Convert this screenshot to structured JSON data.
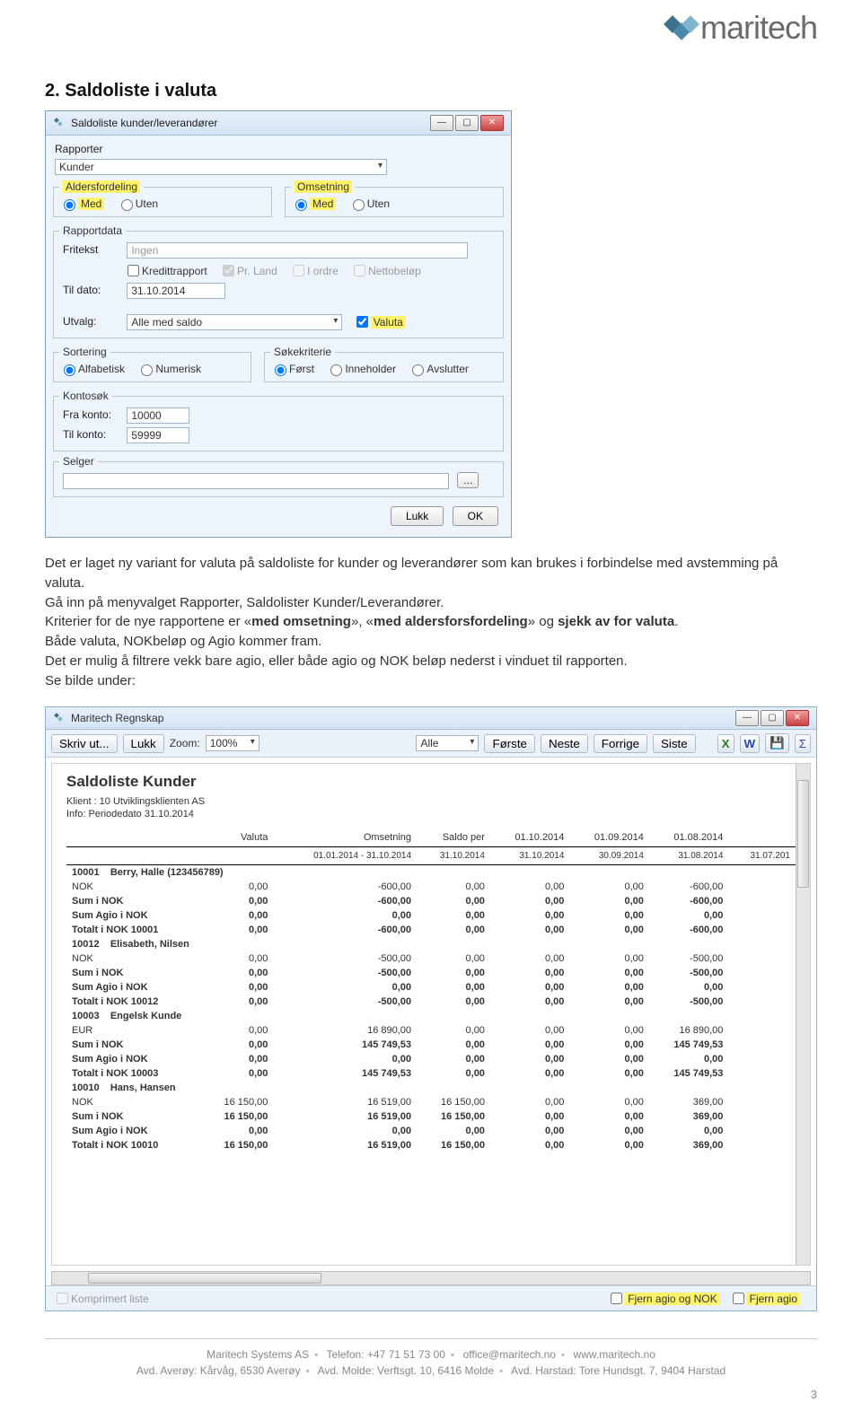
{
  "logo": "maritech",
  "heading": "2.      Saldoliste i valuta",
  "dlg1": {
    "title": "Saldoliste kunder/leverandører",
    "menu_rapporter": "Rapporter",
    "kunder_value": "Kunder",
    "aldersfordeling_legend": "Aldersfordeling",
    "omsetning_legend": "Omsetning",
    "med": "Med",
    "uten": "Uten",
    "rapportdata_legend": "Rapportdata",
    "fritekst_label": "Fritekst",
    "fritekst_value": "Ingen",
    "kredittrapport": "Kredittrapport",
    "pr_land": "Pr. Land",
    "i_ordre": "I ordre",
    "nettobelop": "Nettobeløp",
    "til_dato_label": "Til dato:",
    "til_dato_value": "31.10.2014",
    "utvalg_label": "Utvalg:",
    "utvalg_value": "Alle med saldo",
    "valuta": "Valuta",
    "sortering_legend": "Sortering",
    "alfabetisk": "Alfabetisk",
    "numerisk": "Numerisk",
    "sokekriterie_legend": "Søkekriterie",
    "forst": "Først",
    "inneholder": "Inneholder",
    "avslutter": "Avslutter",
    "kontosok_legend": "Kontosøk",
    "fra_konto_label": "Fra konto:",
    "fra_konto_value": "10000",
    "til_konto_label": "Til konto:",
    "til_konto_value": "59999",
    "selger_legend": "Selger",
    "browse": "...",
    "lukk": "Lukk",
    "ok": "OK"
  },
  "body_text": {
    "p1a": "Det er laget ny variant for valuta på saldoliste for kunder og leverandører som kan brukes i forbindelse med avstemming på valuta.",
    "p1b": "Gå inn på menyvalget Rapporter, Saldolister Kunder/Leverandører.",
    "p2a": "Kriterier for de nye rapportene er «",
    "p2b": "med omsetning",
    "p2c": "», «",
    "p2d": "med aldersforsfordeling",
    "p2e": "» og ",
    "p2f": "sjekk av for valuta",
    "p2g": ".",
    "p3": "Både valuta, NOKbeløp og Agio kommer fram.",
    "p4": "Det er mulig å filtrere vekk bare agio, eller både agio og NOK beløp nederst i vinduet til rapporten.",
    "p5": "Se bilde under:"
  },
  "rpt": {
    "title": "Maritech Regnskap",
    "tb_skrivut": "Skriv ut...",
    "tb_lukk": "Lukk",
    "tb_zoom_label": "Zoom:",
    "tb_zoom_value": "100%",
    "tb_alle": "Alle",
    "tb_forste": "Første",
    "tb_neste": "Neste",
    "tb_forrige": "Forrige",
    "tb_siste": "Siste",
    "report_title": "Saldoliste Kunder",
    "klient": "Klient :  10  Utviklingsklienten AS",
    "info": "Info:      Periodedato 31.10.2014",
    "headers": [
      "",
      "Valuta",
      "Omsetning",
      "Saldo per",
      "01.10.2014",
      "01.09.2014",
      "01.08.2014",
      ""
    ],
    "sub_headers": [
      "",
      "",
      "01.01.2014 - 31.10.2014",
      "31.10.2014",
      "31.10.2014",
      "30.09.2014",
      "31.08.2014",
      "31.07.201"
    ],
    "customers": [
      {
        "id": "10001",
        "name": "Berry, Halle (123456789)",
        "rows": [
          [
            "NOK",
            "0,00",
            "-600,00",
            "0,00",
            "0,00",
            "0,00",
            "-600,00"
          ],
          [
            "Sum i NOK",
            "0,00",
            "-600,00",
            "0,00",
            "0,00",
            "0,00",
            "-600,00"
          ],
          [
            "Sum Agio i NOK",
            "0,00",
            "0,00",
            "0,00",
            "0,00",
            "0,00",
            "0,00"
          ],
          [
            "Totalt i NOK 10001",
            "0,00",
            "-600,00",
            "0,00",
            "0,00",
            "0,00",
            "-600,00"
          ]
        ]
      },
      {
        "id": "10012",
        "name": "Elisabeth, Nilsen",
        "rows": [
          [
            "NOK",
            "0,00",
            "-500,00",
            "0,00",
            "0,00",
            "0,00",
            "-500,00"
          ],
          [
            "Sum i NOK",
            "0,00",
            "-500,00",
            "0,00",
            "0,00",
            "0,00",
            "-500,00"
          ],
          [
            "Sum Agio i NOK",
            "0,00",
            "0,00",
            "0,00",
            "0,00",
            "0,00",
            "0,00"
          ],
          [
            "Totalt i NOK 10012",
            "0,00",
            "-500,00",
            "0,00",
            "0,00",
            "0,00",
            "-500,00"
          ]
        ]
      },
      {
        "id": "10003",
        "name": "Engelsk Kunde",
        "rows": [
          [
            "EUR",
            "0,00",
            "16 890,00",
            "0,00",
            "0,00",
            "0,00",
            "16 890,00"
          ],
          [
            "Sum i NOK",
            "0,00",
            "145 749,53",
            "0,00",
            "0,00",
            "0,00",
            "145 749,53"
          ],
          [
            "Sum Agio i NOK",
            "0,00",
            "0,00",
            "0,00",
            "0,00",
            "0,00",
            "0,00"
          ],
          [
            "Totalt i NOK 10003",
            "0,00",
            "145 749,53",
            "0,00",
            "0,00",
            "0,00",
            "145 749,53"
          ]
        ]
      },
      {
        "id": "10010",
        "name": "Hans, Hansen",
        "rows": [
          [
            "NOK",
            "16 150,00",
            "16 519,00",
            "16 150,00",
            "0,00",
            "0,00",
            "369,00"
          ],
          [
            "Sum i NOK",
            "16 150,00",
            "16 519,00",
            "16 150,00",
            "0,00",
            "0,00",
            "369,00"
          ],
          [
            "Sum Agio i NOK",
            "0,00",
            "0,00",
            "0,00",
            "0,00",
            "0,00",
            "0,00"
          ],
          [
            "Totalt i NOK 10010",
            "16 150,00",
            "16 519,00",
            "16 150,00",
            "0,00",
            "0,00",
            "369,00"
          ]
        ]
      }
    ],
    "komprimer": "Komprimert liste",
    "fjern_agio_nok": "Fjern agio og NOK",
    "fjern_agio": "Fjern agio"
  },
  "footer": {
    "l1a": "Maritech Systems AS",
    "l1b": "Telefon: +47 71 51 73 00",
    "l1c": "office@maritech.no",
    "l1d": "www.maritech.no",
    "l2a": "Avd. Averøy: Kårvåg, 6530 Averøy",
    "l2b": "Avd. Molde: Verftsgt. 10, 6416 Molde",
    "l2c": "Avd. Harstad: Tore Hundsgt. 7, 9404 Harstad",
    "page": "3"
  }
}
